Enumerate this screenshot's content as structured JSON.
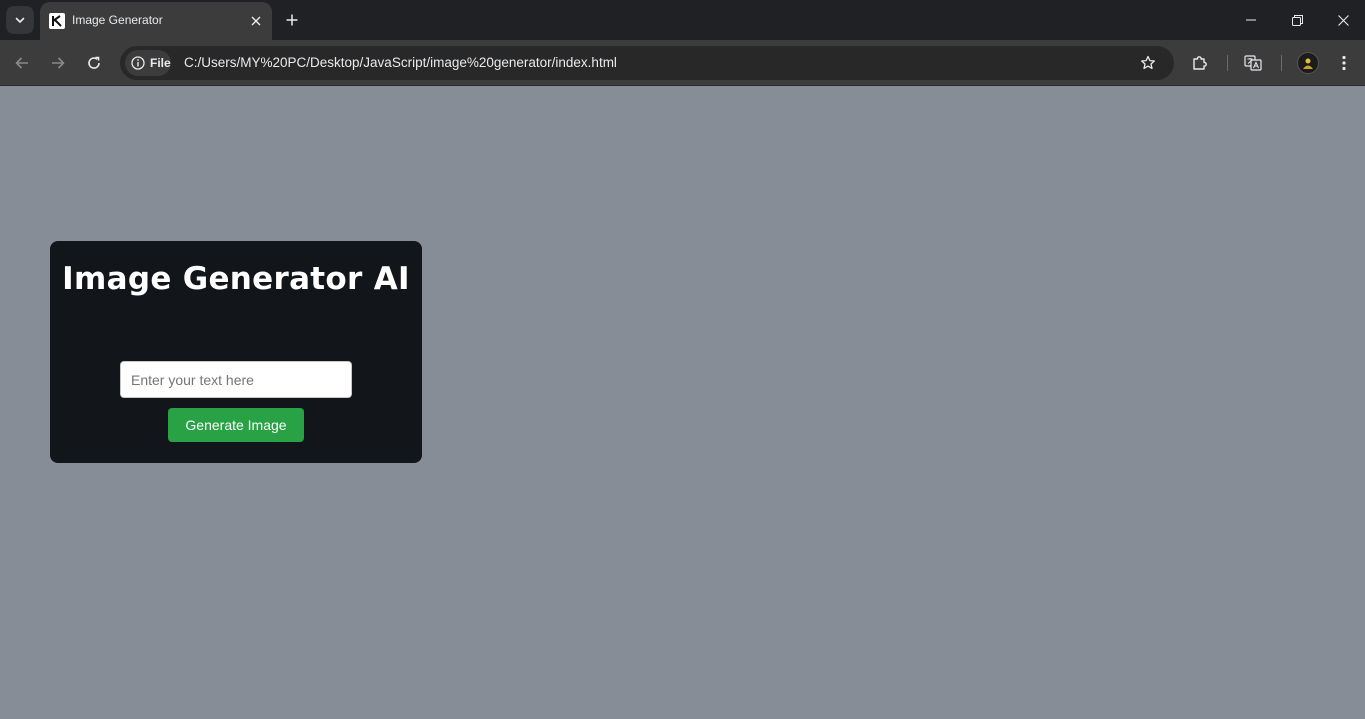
{
  "browser": {
    "tab": {
      "title": "Image Generator"
    },
    "address_bar": {
      "chip_label": "File",
      "url": "C:/Users/MY%20PC/Desktop/JavaScript/image%20generator/index.html"
    }
  },
  "page": {
    "background_color": "#878d97",
    "card": {
      "title": "Image Generator AI",
      "input": {
        "placeholder": "Enter your text here",
        "value": ""
      },
      "button_label": "Generate Image",
      "button_color": "#28a245",
      "background_color": "#121519"
    }
  },
  "icons": {
    "tab_search": "chevron-down-icon",
    "favicon": "site-favicon",
    "tab_close": "close-icon",
    "new_tab": "plus-icon",
    "back": "back-arrow-icon",
    "forward": "forward-arrow-icon",
    "reload": "reload-icon",
    "site_info": "info-icon",
    "bookmark": "star-icon",
    "extensions": "puzzle-icon",
    "translate": "translate-icon",
    "profile": "avatar",
    "menu": "kebab-menu-icon",
    "minimize": "minimize-icon",
    "maximize": "restore-icon",
    "close_window": "close-icon"
  }
}
